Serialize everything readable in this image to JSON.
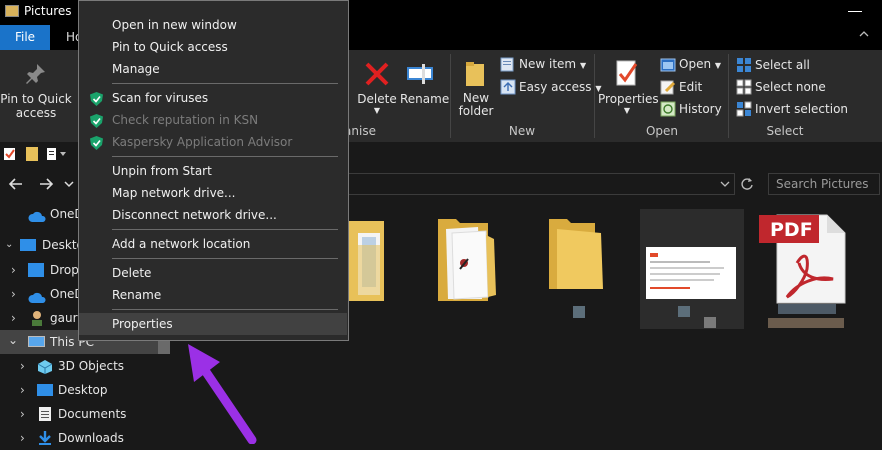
{
  "window": {
    "title": "Pictures"
  },
  "ribbon_tabs": {
    "file": "File",
    "home": "Ho"
  },
  "ribbon": {
    "pin_label_1": "Pin to Quick",
    "pin_label_2": "access",
    "delete": "Delete",
    "rename": "Rename",
    "organise_group": "anise",
    "new_folder_1": "New",
    "new_folder_2": "folder",
    "new_item": "New item",
    "easy_access": "Easy access",
    "new_group": "New",
    "properties": "Properties",
    "open": "Open",
    "edit": "Edit",
    "history": "History",
    "open_group": "Open",
    "select_all": "Select all",
    "select_none": "Select none",
    "invert_selection": "Invert selection",
    "select_group": "Select"
  },
  "search": {
    "placeholder": "Search Pictures"
  },
  "nav": {
    "items": [
      {
        "label": "OneD"
      },
      {
        "label": "Deskto"
      },
      {
        "label": "Drop"
      },
      {
        "label": "OneD"
      },
      {
        "label": "gaura"
      },
      {
        "label": "This PC"
      },
      {
        "label": "3D Objects"
      },
      {
        "label": "Desktop"
      },
      {
        "label": "Documents"
      },
      {
        "label": "Downloads"
      }
    ]
  },
  "context_menu": {
    "items": [
      {
        "label": "Open in new window"
      },
      {
        "label": "Pin to Quick access"
      },
      {
        "label": "Manage"
      },
      {
        "label": "Scan for viruses"
      },
      {
        "label": "Check reputation in KSN"
      },
      {
        "label": "Kaspersky Application Advisor"
      },
      {
        "label": "Unpin from Start"
      },
      {
        "label": "Map network drive..."
      },
      {
        "label": "Disconnect network drive..."
      },
      {
        "label": "Add a network location"
      },
      {
        "label": "Delete"
      },
      {
        "label": "Rename"
      },
      {
        "label": "Properties"
      }
    ]
  },
  "content": {
    "pdf_badge": "PDF"
  },
  "colors": {
    "accent": "#1a73c9",
    "arrow": "#9b30e6",
    "folder": "#e8c15a",
    "kaspersky_shield": "#1aa36b",
    "pdf_red": "#c0272d"
  }
}
